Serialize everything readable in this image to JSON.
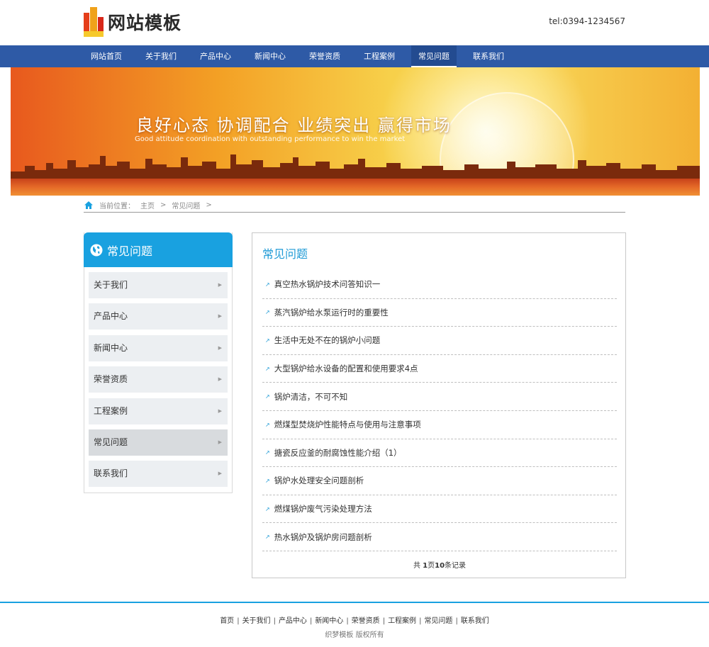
{
  "header": {
    "logo_text": "网站模板",
    "tel": "tel:0394-1234567"
  },
  "nav": {
    "items": [
      "网站首页",
      "关于我们",
      "产品中心",
      "新闻中心",
      "荣誉资质",
      "工程案例",
      "常见问题",
      "联系我们"
    ],
    "active": "常见问题"
  },
  "banner": {
    "slogan": "良好心态  协调配合  业绩突出  赢得市场",
    "slogan_en": "Good attitude coordination with outstanding performance to win the market"
  },
  "breadcrumb": {
    "label": "当前位置：",
    "home": "主页",
    "sep1": ">",
    "current": "常见问题",
    "sep2": ">"
  },
  "sidebar": {
    "title": "常见问题",
    "items": [
      "关于我们",
      "产品中心",
      "新闻中心",
      "荣誉资质",
      "工程案例",
      "常见问题",
      "联系我们"
    ],
    "active_index": 5
  },
  "content": {
    "title": "常见问题",
    "articles": [
      "真空热水锅炉技术问答知识一",
      "蒸汽锅炉给水泵运行时的重要性",
      "生活中无处不在的锅炉小问题",
      "大型锅炉给水设备的配置和使用要求4点",
      "锅炉清洁，不可不知",
      "燃煤型焚烧炉性能特点与使用与注意事项",
      "搪瓷反应釜的耐腐蚀性能介绍（1）",
      "锅炉水处理安全问题剖析",
      "燃煤锅炉废气污染处理方法",
      "热水锅炉及锅炉房问题剖析"
    ],
    "pager": {
      "prefix": "共 ",
      "pages": "1",
      "mid": "页",
      "records": "10",
      "suffix": "条记录"
    }
  },
  "footer": {
    "links": [
      "首页",
      "关于我们",
      "产品中心",
      "新闻中心",
      "荣誉资质",
      "工程案例",
      "常见问题",
      "联系我们"
    ],
    "copyright": "织梦模板 版权所有"
  },
  "colors": {
    "nav_bg": "#2e5aa6",
    "accent": "#19a1e0",
    "title_blue": "#1e9ad6"
  }
}
